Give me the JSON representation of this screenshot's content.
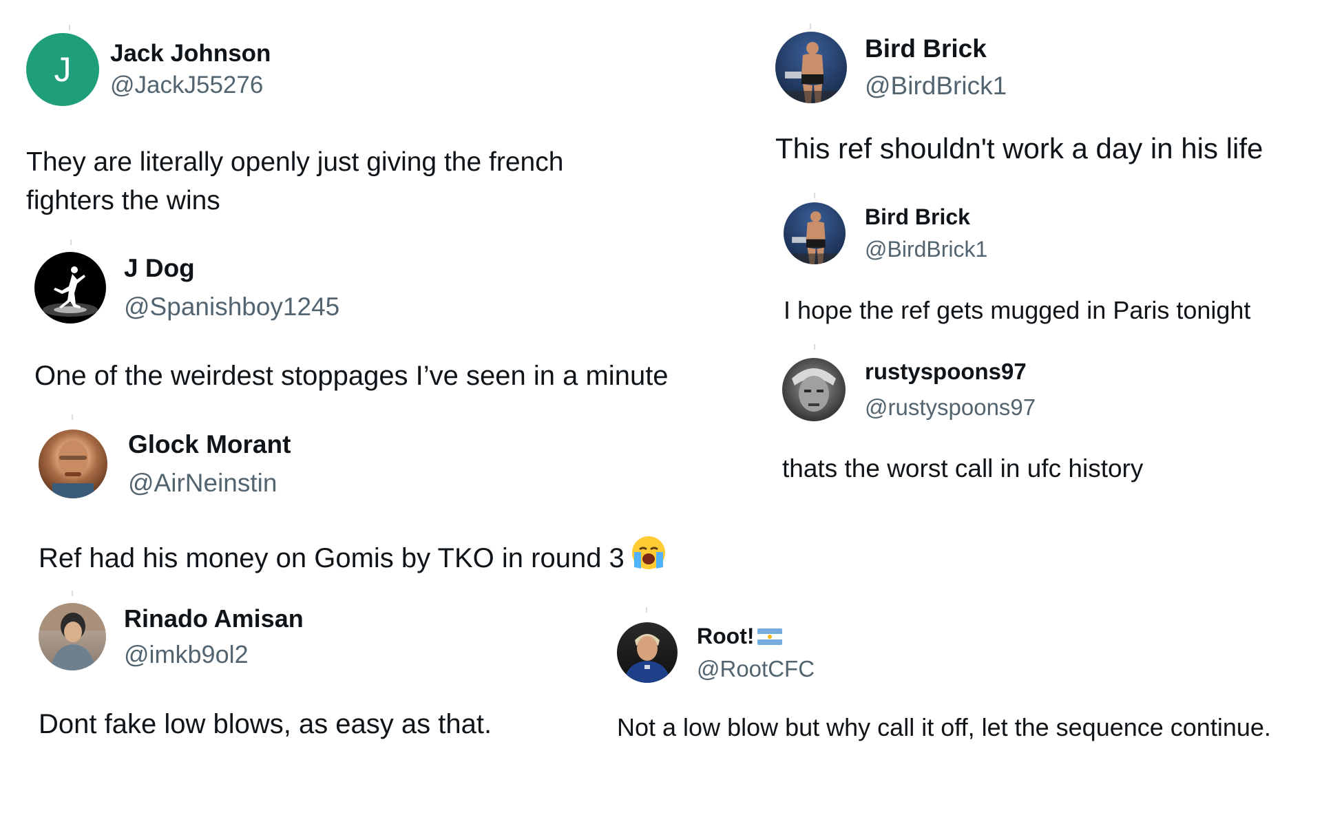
{
  "tweets": [
    {
      "id": "jack-johnson",
      "display_name": "Jack Johnson",
      "handle": "@JackJ55276",
      "avatar_letter": "J",
      "avatar_color": "#1f9e7a",
      "text": "They are literally openly just giving the french fighters the wins"
    },
    {
      "id": "j-dog",
      "display_name": "J Dog",
      "handle": "@Spanishboy1245",
      "avatar_icon": "jumpman-logo-icon",
      "text": "One of the weirdest stoppages I’ve seen in a minute"
    },
    {
      "id": "glock-morant",
      "display_name": "Glock Morant",
      "handle": "@AirNeinstin",
      "avatar_icon": "profile-photo",
      "text": "Ref had his money on Gomis by TKO in round 3",
      "emoji": "loudly-crying-face-emoji"
    },
    {
      "id": "rinado-amisan",
      "display_name": "Rinado Amisan",
      "handle": "@imkb9ol2",
      "avatar_icon": "profile-photo",
      "text": "Dont fake low blows, as easy as that."
    },
    {
      "id": "bird-brick-1",
      "display_name": "Bird Brick",
      "handle": "@BirdBrick1",
      "avatar_icon": "fighter-profile-photo",
      "text": "This ref shouldn't work a day in his life"
    },
    {
      "id": "bird-brick-2",
      "display_name": "Bird Brick",
      "handle": "@BirdBrick1",
      "avatar_icon": "fighter-profile-photo",
      "text": "I hope the ref gets mugged in Paris tonight"
    },
    {
      "id": "rustyspoons97",
      "display_name": "rustyspoons97",
      "handle": "@rustyspoons97",
      "avatar_icon": "grayscale-profile-photo",
      "text": "thats the worst call in ufc history"
    },
    {
      "id": "root",
      "display_name": "Root!",
      "display_name_flag": "argentina-flag-icon",
      "handle": "@RootCFC",
      "avatar_icon": "footballer-profile-photo",
      "text": "Not a low blow but why call it off, let the sequence continue."
    }
  ],
  "colors": {
    "name": "#0f1419",
    "handle": "#536471",
    "text": "#0f1419",
    "background": "#ffffff"
  }
}
